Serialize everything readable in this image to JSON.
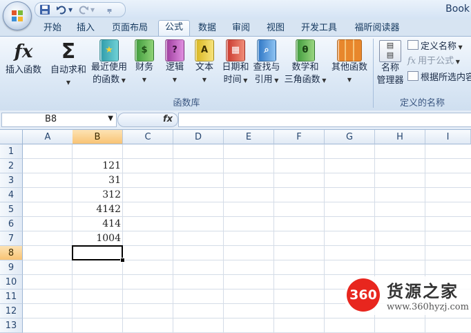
{
  "app": {
    "title": "Book"
  },
  "qat": {
    "save_icon": "save-icon",
    "undo_icon": "undo-icon",
    "redo_icon": "redo-icon",
    "customize_icon": "customize-qat-icon"
  },
  "tabs": [
    {
      "label": "开始"
    },
    {
      "label": "插入"
    },
    {
      "label": "页面布局"
    },
    {
      "label": "公式",
      "active": true
    },
    {
      "label": "数据"
    },
    {
      "label": "审阅"
    },
    {
      "label": "视图"
    },
    {
      "label": "开发工具"
    },
    {
      "label": "福昕阅读器"
    }
  ],
  "ribbon": {
    "function_library": {
      "label": "函数库",
      "buttons": [
        {
          "line1": "插入函数",
          "line2": "",
          "icon": "fx-icon"
        },
        {
          "line1": "自动求和",
          "line2": "",
          "icon": "sigma-icon",
          "dropdown": true
        },
        {
          "line1": "最近使用",
          "line2": "的函数",
          "icon": "recent-book-icon",
          "dropdown": true
        },
        {
          "line1": "财务",
          "line2": "",
          "icon": "finance-book-icon",
          "dropdown": true
        },
        {
          "line1": "逻辑",
          "line2": "",
          "icon": "logic-book-icon",
          "dropdown": true
        },
        {
          "line1": "文本",
          "line2": "",
          "icon": "text-book-icon",
          "dropdown": true
        },
        {
          "line1": "日期和",
          "line2": "时间",
          "icon": "datetime-book-icon",
          "dropdown": true
        },
        {
          "line1": "查找与",
          "line2": "引用",
          "icon": "lookup-book-icon",
          "dropdown": true
        },
        {
          "line1": "数学和",
          "line2": "三角函数",
          "icon": "math-book-icon",
          "dropdown": true
        },
        {
          "line1": "其他函数",
          "line2": "",
          "icon": "other-books-icon",
          "dropdown": true
        }
      ]
    },
    "defined_names": {
      "label": "定义的名称",
      "name_manager": {
        "line1": "名称",
        "line2": "管理器",
        "icon": "name-manager-icon"
      },
      "define_name": "定义名称",
      "use_in_formula": "用于公式",
      "create_from_selection": "根据所选内容"
    }
  },
  "formula_bar": {
    "name_box": "B8",
    "fx_label": "fx",
    "formula": ""
  },
  "sheet": {
    "columns": [
      "A",
      "B",
      "C",
      "D",
      "E",
      "F",
      "G",
      "H",
      "I"
    ],
    "selected_column": "B",
    "rows": [
      "1",
      "2",
      "3",
      "4",
      "5",
      "6",
      "7",
      "8",
      "9",
      "10",
      "11",
      "12",
      "13"
    ],
    "selected_row": "8",
    "cells": {
      "B2": "121",
      "B3": "31",
      "B4": "312",
      "B5": "4142",
      "B6": "414",
      "B7": "1004"
    },
    "active_cell": "B8"
  },
  "watermark": {
    "badge": "360",
    "name": "货源之家",
    "url": "www.360hyzj.com"
  }
}
